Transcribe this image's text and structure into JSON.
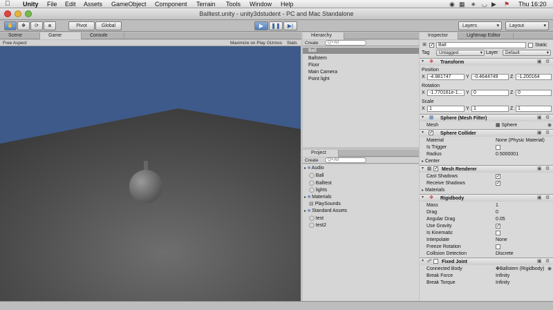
{
  "menubar": {
    "apple": "",
    "items": [
      "Unity",
      "File",
      "Edit",
      "Assets",
      "GameObject",
      "Component",
      "Terrain",
      "Tools",
      "Window",
      "Help"
    ],
    "clock": "Thu 16:20",
    "tray": [
      "camera-icon",
      "screen-icon",
      "bluetooth-icon",
      "wifi-icon",
      "volume-icon",
      "flag-icon"
    ]
  },
  "window": {
    "title": "Balltest.unity - unity3dstudent - PC and Mac Standalone"
  },
  "toolbar": {
    "tools": [
      "hand-icon",
      "move-icon",
      "rotate-icon",
      "scale-icon"
    ],
    "pivot": "Pivot",
    "global": "Global",
    "play": "play-icon",
    "pause": "pause-icon",
    "step": "step-icon",
    "layers": "Layers",
    "layout": "Layout"
  },
  "scene_panel": {
    "tabs": [
      "Scene",
      "Game",
      "Console"
    ],
    "active_tab": "Game",
    "aspect": "Free Aspect",
    "maximize": "Maximize on Play",
    "gizmos": "Gizmos",
    "stats": "Stats"
  },
  "hierarchy": {
    "tab": "Hierarchy",
    "create": "Create",
    "search": "Q+All",
    "items": [
      "Ball",
      "Ballstem",
      "Floor",
      "Main Camera",
      "Point light"
    ],
    "selected": "Ball"
  },
  "project": {
    "tab": "Project",
    "create": "Create",
    "search": "Q+All",
    "items": [
      {
        "name": "Audio",
        "type": "folder",
        "expanded": false
      },
      {
        "name": "Ball",
        "type": "asset"
      },
      {
        "name": "Balltest",
        "type": "scene"
      },
      {
        "name": "lights",
        "type": "asset"
      },
      {
        "name": "Materials",
        "type": "folder",
        "expanded": false
      },
      {
        "name": "PlaySounds",
        "type": "script"
      },
      {
        "name": "Standard Assets",
        "type": "folder",
        "expanded": false
      },
      {
        "name": "test",
        "type": "asset"
      },
      {
        "name": "test2",
        "type": "asset"
      }
    ]
  },
  "inspector": {
    "tabs": [
      "Inspector",
      "Lightmap Editor"
    ],
    "object_name": "Ball",
    "static_label": "Static",
    "tag_label": "Tag",
    "tag_value": "Untagged",
    "layer_label": "Layer",
    "layer_value": "Default",
    "transform": {
      "title": "Transform",
      "position_label": "Position",
      "position": {
        "x": "-4.981747",
        "y": "-0.4644749",
        "z": "-1.200164"
      },
      "rotation_label": "Rotation",
      "rotation": {
        "x": "-1.770161e-1...",
        "y": "0",
        "z": "0"
      },
      "scale_label": "Scale",
      "scale": {
        "x": "1",
        "y": "1",
        "z": "1"
      }
    },
    "mesh_filter": {
      "title": "Sphere (Mesh Filter)",
      "mesh_label": "Mesh",
      "mesh_value": "Sphere"
    },
    "sphere_collider": {
      "title": "Sphere Collider",
      "material_label": "Material",
      "material_value": "None (Physic Material)",
      "trigger_label": "Is Trigger",
      "radius_label": "Radius",
      "radius_value": "0.5000001",
      "center_label": "Center"
    },
    "mesh_renderer": {
      "title": "Mesh Renderer",
      "cast_label": "Cast Shadows",
      "receive_label": "Receive Shadows",
      "materials_label": "Materials"
    },
    "rigidbody": {
      "title": "Rigidbody",
      "mass_label": "Mass",
      "mass_value": "1",
      "drag_label": "Drag",
      "drag_value": "0",
      "angular_label": "Angular Drag",
      "angular_value": "0.05",
      "gravity_label": "Use Gravity",
      "kinematic_label": "Is Kinematic",
      "interpolate_label": "Interpolate",
      "interpolate_value": "None",
      "freeze_label": "Freeze Rotation",
      "collision_label": "Collision Detection",
      "collision_value": "Discrete"
    },
    "fixed_joint": {
      "title": "Fixed Joint",
      "body_label": "Connected Body",
      "body_value": "Ballstem (Rigidbody)",
      "force_label": "Break Force",
      "force_value": "Infinity",
      "torque_label": "Break Torque",
      "torque_value": "Infinity"
    }
  },
  "colors": {
    "sky": "#3d5a8a",
    "floor": "#565656",
    "accent": "#4f7fbf"
  }
}
